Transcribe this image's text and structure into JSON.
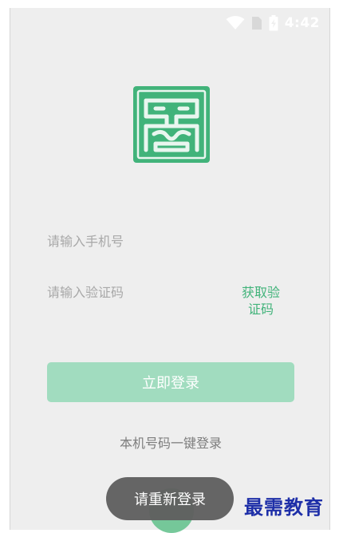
{
  "status_bar": {
    "time": "4:42",
    "icons": [
      "wifi-icon",
      "sim-icon",
      "battery-charging-icon"
    ]
  },
  "logo": {
    "icon": "app-logo-seal",
    "color": "#41b37a"
  },
  "form": {
    "phone_placeholder": "请输入手机号",
    "code_placeholder": "请输入验证码",
    "get_code_line1": "获取验",
    "get_code_line2": "证码",
    "login_label": "立即登录",
    "one_key_login_label": "本机号码一键登录"
  },
  "toast": {
    "message": "请重新登录"
  },
  "watermark": {
    "text": "最需教育"
  },
  "colors": {
    "accent": "#41b37a",
    "button_disabled": "#a1dcbf",
    "background": "#eeeeee",
    "toast_bg": "#5f5f5f",
    "watermark": "#1e2fa8"
  }
}
